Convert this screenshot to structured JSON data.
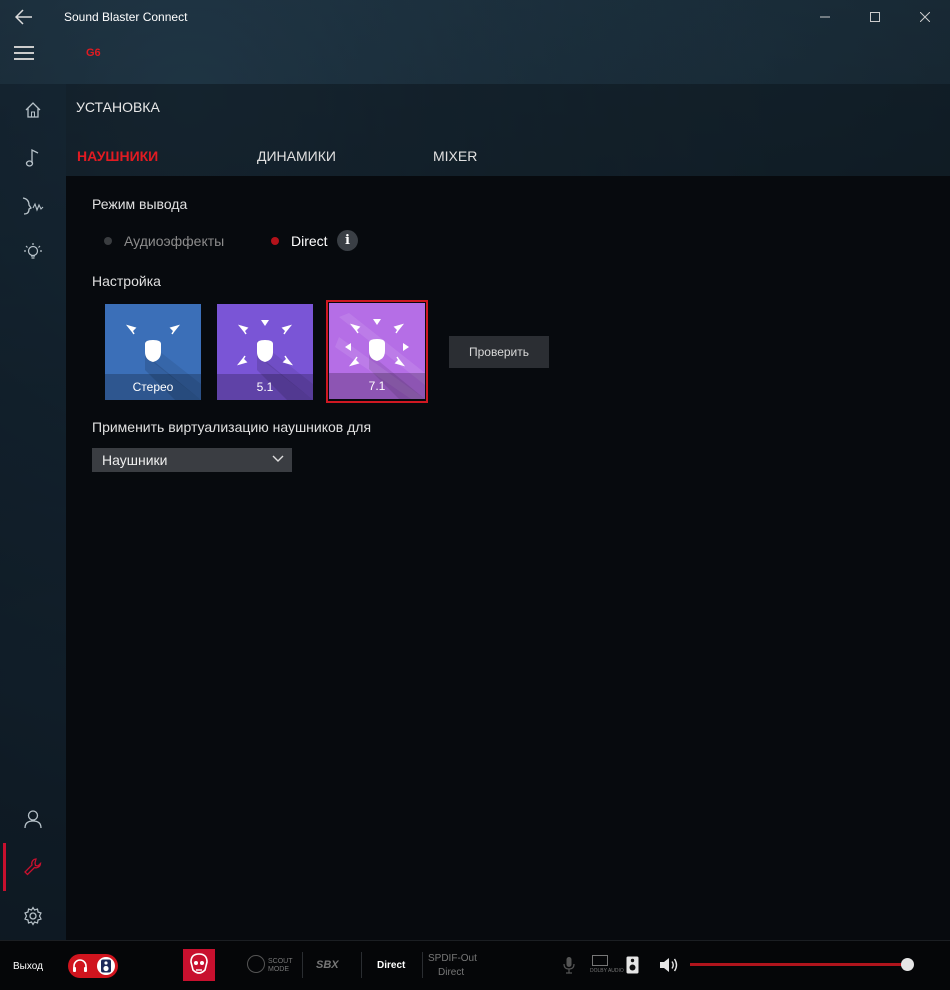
{
  "app": {
    "title": "Sound Blaster Connect",
    "device": "G6"
  },
  "window_controls": {
    "minimize": "—",
    "maximize": "☐",
    "close": "✕"
  },
  "header": {
    "section_title": "УСТАНОВКА",
    "tabs": [
      {
        "label": "НАУШНИКИ",
        "active": true
      },
      {
        "label": "ДИНАМИКИ",
        "active": false
      },
      {
        "label": "MIXER",
        "active": false
      }
    ]
  },
  "output_mode": {
    "label": "Режим вывода",
    "options": [
      {
        "label": "Аудиоэффекты",
        "selected": false
      },
      {
        "label": "Direct",
        "selected": true
      }
    ],
    "info": "i"
  },
  "config": {
    "label": "Настройка",
    "tiles": [
      {
        "label": "Стерео",
        "color": "#3b6fb8",
        "selected": false
      },
      {
        "label": "5.1",
        "color": "#7a55d6",
        "selected": false
      },
      {
        "label": "7.1",
        "color": "#b56ee6",
        "selected": true
      }
    ],
    "test_button": "Проверить"
  },
  "virtualization": {
    "label": "Применить виртуализацию наушников для",
    "selected": "Наушники"
  },
  "status_bar": {
    "output_label": "Выход",
    "scout_mode": "SCOUT MODE",
    "sbx": "SBX",
    "direct": "Direct",
    "spdif_label": "SPDIF-Out",
    "spdif_value": "Direct",
    "dolby": "DOLBY AUDIO",
    "volume_percent": 100
  },
  "colors": {
    "accent": "#e11b22",
    "sidebar_active": "#c8102e"
  }
}
